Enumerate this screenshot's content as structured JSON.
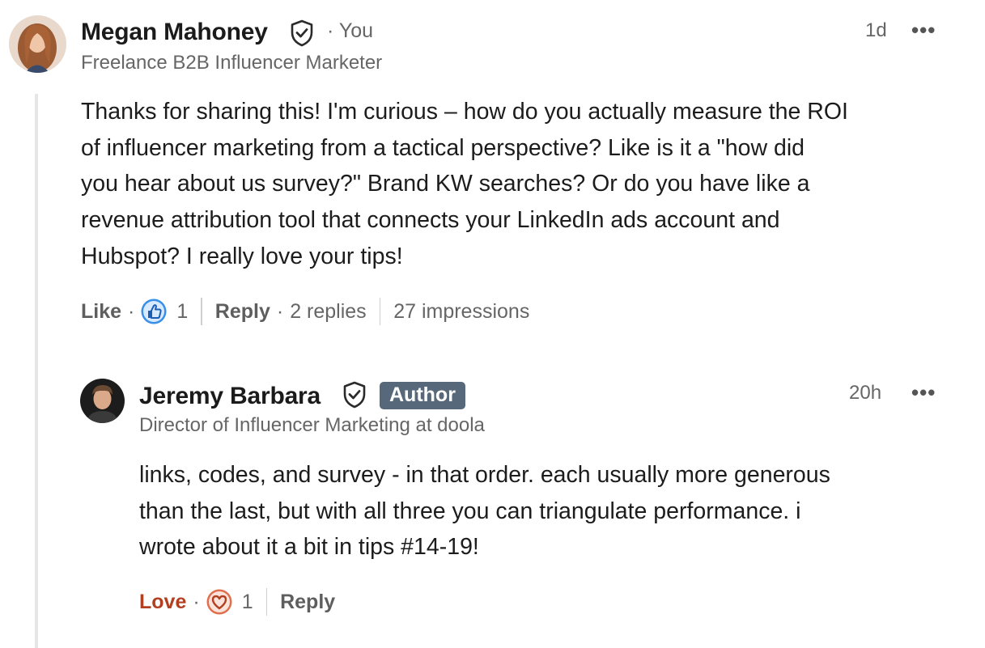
{
  "comment": {
    "author_name": "Megan Mahoney",
    "you_label": "· You",
    "headline": "Freelance B2B Influencer Marketer",
    "time": "1d",
    "more_label": "•••",
    "body_lines": [
      "Thanks for sharing this! I'm curious – how do you actually measure the ROI",
      "of influencer marketing from a tactical perspective? Like is it a \"how did",
      "you hear about us survey?\" Brand KW searches? Or do you have like a",
      "revenue attribution tool that connects your LinkedIn ads account and",
      "Hubspot? I really love your tips!"
    ],
    "actions": {
      "like_label": "Like",
      "dot": "·",
      "reaction_count": "1",
      "reply_label": "Reply",
      "replies_label": "2 replies",
      "impressions_label": "27 impressions"
    },
    "reaction_icon": "thumbs-up-icon"
  },
  "reply": {
    "author_name": "Jeremy Barbara",
    "badge": "Author",
    "headline": "Director of Influencer Marketing at doola",
    "time": "20h",
    "more_label": "•••",
    "body_lines": [
      "links, codes, and survey - in that order. each usually more generous",
      "than the last, but with all three you can triangulate performance. i",
      "wrote about it a bit in tips #14-19!"
    ],
    "actions": {
      "love_label": "Love",
      "dot": "·",
      "reaction_count": "1",
      "reply_label": "Reply"
    },
    "reaction_icon": "heart-icon"
  },
  "colors": {
    "love": "#b24020",
    "like_blue": "#378fe9",
    "badge_bg": "#56687a"
  }
}
